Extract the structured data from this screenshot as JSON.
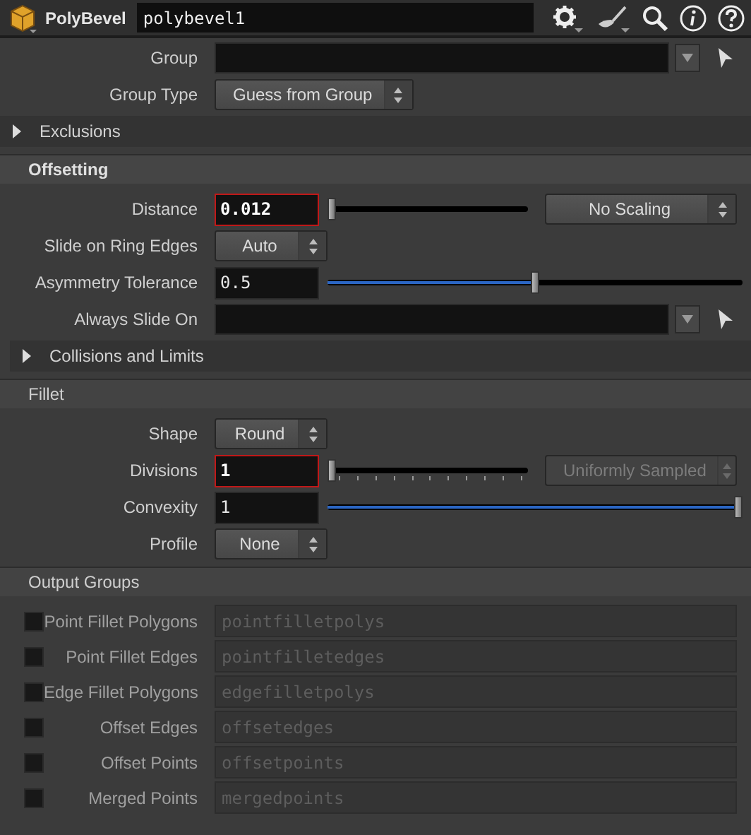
{
  "header": {
    "node_type": "PolyBevel",
    "node_name": "polybevel1"
  },
  "sections": [
    {
      "kind": "plain",
      "rows": [
        {
          "kind": "group",
          "label": "Group"
        },
        {
          "kind": "menu",
          "label": "Group Type",
          "value": "Guess from Group"
        },
        {
          "kind": "folder",
          "label": "Exclusions",
          "expanded": false
        }
      ]
    },
    {
      "kind": "heading",
      "title": "Offsetting",
      "emphasized": true,
      "rows": [
        {
          "kind": "float",
          "label": "Distance",
          "value": "0.012",
          "alert": true,
          "level": 0,
          "menu": {
            "value": "No Scaling",
            "disabled": false
          }
        },
        {
          "kind": "menu",
          "label": "Slide on Ring Edges",
          "value": "Auto"
        },
        {
          "kind": "float",
          "label": "Asymmetry Tolerance",
          "value": "0.5",
          "alert": false,
          "level": 0.5
        },
        {
          "kind": "group",
          "label": "Always Slide On"
        },
        {
          "kind": "folder",
          "label": "Collisions and Limits",
          "expanded": false
        }
      ]
    },
    {
      "kind": "heading",
      "title": "Fillet",
      "emphasized": false,
      "rows": [
        {
          "kind": "menu",
          "label": "Shape",
          "value": "Round"
        },
        {
          "kind": "int",
          "label": "Divisions",
          "value": "1",
          "alert": true,
          "level": 0,
          "menu": {
            "value": "Uniformly Sampled",
            "disabled": true
          }
        },
        {
          "kind": "float",
          "label": "Convexity",
          "value": "1",
          "alert": false,
          "level": 1
        },
        {
          "kind": "menu",
          "label": "Profile",
          "value": "None"
        }
      ]
    },
    {
      "kind": "heading",
      "title": "Output Groups",
      "emphasized": false,
      "rows": [
        {
          "kind": "output",
          "label": "Point Fillet Polygons",
          "checked": false,
          "value": "pointfilletpolys"
        },
        {
          "kind": "output",
          "label": "Point Fillet Edges",
          "checked": false,
          "value": "pointfilletedges"
        },
        {
          "kind": "output",
          "label": "Edge Fillet Polygons",
          "checked": false,
          "value": "edgefilletpolys"
        },
        {
          "kind": "output",
          "label": "Offset Edges",
          "checked": false,
          "value": "offsetedges"
        },
        {
          "kind": "output",
          "label": "Offset Points",
          "checked": false,
          "value": "offsetpoints"
        },
        {
          "kind": "output",
          "label": "Merged Points",
          "checked": false,
          "value": "mergedpoints"
        }
      ]
    }
  ]
}
